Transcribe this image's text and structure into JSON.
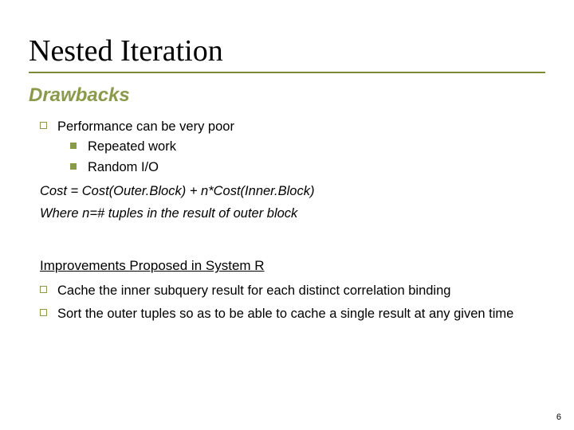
{
  "title": "Nested Iteration",
  "subhead": "Drawbacks",
  "drawbacks": {
    "main": "Performance can be very poor",
    "sub1": "Repeated work",
    "sub2": "Random I/O"
  },
  "formula": "Cost = Cost(Outer.Block) + n*Cost(Inner.Block)",
  "note": "Where n=# tuples in the result of outer block",
  "improvements": {
    "heading": "Improvements Proposed in System R",
    "item1": "Cache the inner subquery result for each distinct correlation binding",
    "item2": "Sort the outer tuples so as to be able to cache a single result at any given time"
  },
  "pagenum": "6"
}
